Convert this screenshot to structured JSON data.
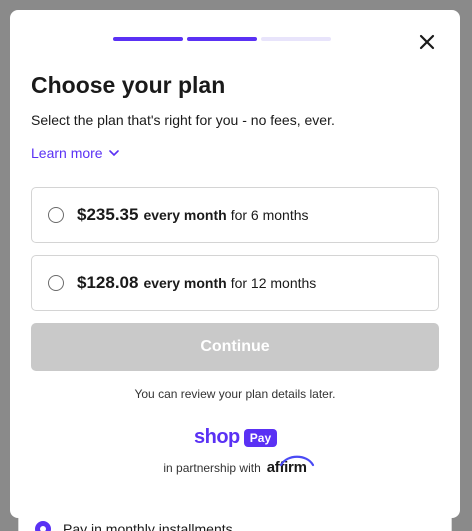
{
  "backdrop": {
    "row_text": "Pay in monthly installments"
  },
  "progress": {
    "steps": 3,
    "current": 2
  },
  "modal": {
    "close_label": "Close",
    "title": "Choose your plan",
    "subtitle": "Select the plan that's right for you - no fees, ever.",
    "learn_more": "Learn more",
    "plans": [
      {
        "amount": "$235.35",
        "frequency": "every month",
        "term": "for 6 months"
      },
      {
        "amount": "$128.08",
        "frequency": "every month",
        "term": "for 12 months"
      }
    ],
    "continue_label": "Continue",
    "review_note": "You can review your plan details later.",
    "shop_pay": {
      "word": "shop",
      "pill": "Pay"
    },
    "partnership_text": "in partnership with",
    "affirm_logo": "affirm"
  },
  "colors": {
    "accent": "#5a31f4",
    "accent_light": "#e8e4fb",
    "disabled_button": "#c9c9c9",
    "overlay": "#8a8a8a"
  }
}
